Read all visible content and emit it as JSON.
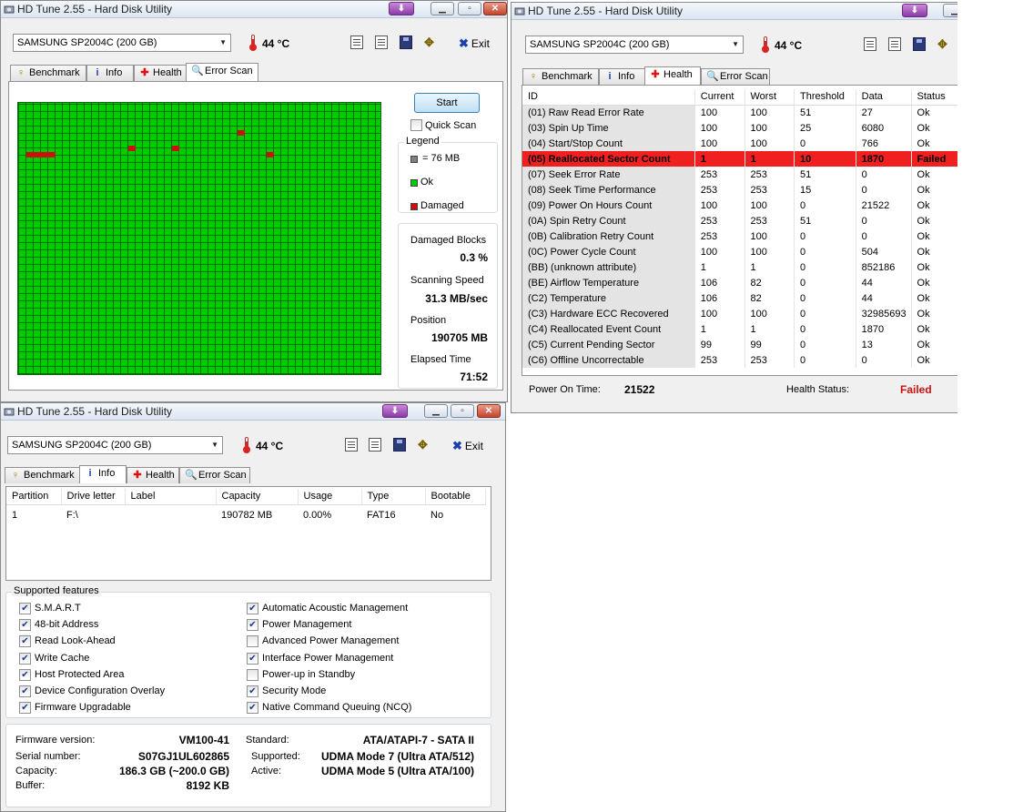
{
  "window_title": "HD Tune 2.55 - Hard Disk Utility",
  "drive": "SAMSUNG SP2004C (200 GB)",
  "temperature": "44 °C",
  "exit_label": "Exit",
  "tabs": {
    "benchmark": "Benchmark",
    "info": "Info",
    "health": "Health",
    "error_scan": "Error Scan"
  },
  "error_scan": {
    "start_label": "Start",
    "quick_scan_label": "Quick Scan",
    "quick_scan_checked": false,
    "legend_title": "Legend",
    "legend_block": "= 76 MB",
    "legend_ok": "Ok",
    "legend_damaged": "Damaged",
    "damaged_blocks_label": "Damaged Blocks",
    "damaged_blocks_value": "0.3 %",
    "scanning_speed_label": "Scanning Speed",
    "scanning_speed_value": "31.3 MB/sec",
    "position_label": "Position",
    "position_value": "190705 MB",
    "elapsed_label": "Elapsed Time",
    "elapsed_value": "71:52",
    "colors": {
      "ok": "#00cc00",
      "damaged": "#cc1010",
      "block": "#808080"
    }
  },
  "health": {
    "columns": [
      "ID",
      "Current",
      "Worst",
      "Threshold",
      "Data",
      "Status"
    ],
    "rows": [
      [
        "(01) Raw Read Error Rate",
        "100",
        "100",
        "51",
        "27",
        "Ok"
      ],
      [
        "(03) Spin Up Time",
        "100",
        "100",
        "25",
        "6080",
        "Ok"
      ],
      [
        "(04) Start/Stop Count",
        "100",
        "100",
        "0",
        "766",
        "Ok"
      ],
      [
        "(05) Reallocated Sector Count",
        "1",
        "1",
        "10",
        "1870",
        "Failed"
      ],
      [
        "(07) Seek Error Rate",
        "253",
        "253",
        "51",
        "0",
        "Ok"
      ],
      [
        "(08) Seek Time Performance",
        "253",
        "253",
        "15",
        "0",
        "Ok"
      ],
      [
        "(09) Power On Hours Count",
        "100",
        "100",
        "0",
        "21522",
        "Ok"
      ],
      [
        "(0A) Spin Retry Count",
        "253",
        "253",
        "51",
        "0",
        "Ok"
      ],
      [
        "(0B) Calibration Retry Count",
        "253",
        "100",
        "0",
        "0",
        "Ok"
      ],
      [
        "(0C) Power Cycle Count",
        "100",
        "100",
        "0",
        "504",
        "Ok"
      ],
      [
        "(BB) (unknown attribute)",
        "1",
        "1",
        "0",
        "852186",
        "Ok"
      ],
      [
        "(BE) Airflow Temperature",
        "106",
        "82",
        "0",
        "44",
        "Ok"
      ],
      [
        "(C2) Temperature",
        "106",
        "82",
        "0",
        "44",
        "Ok"
      ],
      [
        "(C3) Hardware ECC Recovered",
        "100",
        "100",
        "0",
        "32985693",
        "Ok"
      ],
      [
        "(C4) Reallocated Event Count",
        "1",
        "1",
        "0",
        "1870",
        "Ok"
      ],
      [
        "(C5) Current Pending Sector",
        "99",
        "99",
        "0",
        "13",
        "Ok"
      ],
      [
        "(C6) Offline Uncorrectable",
        "253",
        "253",
        "0",
        "0",
        "Ok"
      ]
    ],
    "failed_row_color": "#f02020",
    "power_on_label": "Power On Time:",
    "power_on_value": "21522",
    "health_status_label": "Health Status:",
    "health_status_value": "Failed",
    "health_status_color": "#cc1010"
  },
  "info": {
    "partition_columns": [
      "Partition",
      "Drive letter",
      "Label",
      "Capacity",
      "Usage",
      "Type",
      "Bootable"
    ],
    "partitions": [
      [
        "1",
        "F:\\",
        "",
        "190782 MB",
        "0.00%",
        "FAT16",
        "No"
      ]
    ],
    "features_title": "Supported features",
    "features_left": [
      {
        "label": "S.M.A.R.T",
        "checked": true
      },
      {
        "label": "48-bit Address",
        "checked": true
      },
      {
        "label": "Read Look-Ahead",
        "checked": true
      },
      {
        "label": "Write Cache",
        "checked": true
      },
      {
        "label": "Host Protected Area",
        "checked": true
      },
      {
        "label": "Device Configuration Overlay",
        "checked": true
      },
      {
        "label": "Firmware Upgradable",
        "checked": true
      }
    ],
    "features_right": [
      {
        "label": "Automatic Acoustic Management",
        "checked": true
      },
      {
        "label": "Power Management",
        "checked": true
      },
      {
        "label": "Advanced Power Management",
        "checked": false
      },
      {
        "label": "Interface Power Management",
        "checked": true
      },
      {
        "label": "Power-up in Standby",
        "checked": false
      },
      {
        "label": "Security Mode",
        "checked": true
      },
      {
        "label": "Native Command Queuing (NCQ)",
        "checked": true
      }
    ],
    "firmware_label": "Firmware version:",
    "firmware_value": "VM100-41",
    "serial_label": "Serial number:",
    "serial_value": "S07GJ1UL602865",
    "capacity_label": "Capacity:",
    "capacity_value": "186.3 GB (~200.0 GB)",
    "buffer_label": "Buffer:",
    "buffer_value": "8192 KB",
    "standard_label": "Standard:",
    "standard_value": "ATA/ATAPI-7 - SATA II",
    "supported_label": "Supported:",
    "supported_value": "UDMA Mode 7 (Ultra ATA/512)",
    "active_label": "Active:",
    "active_value": "UDMA Mode 5 (Ultra ATA/100)"
  }
}
